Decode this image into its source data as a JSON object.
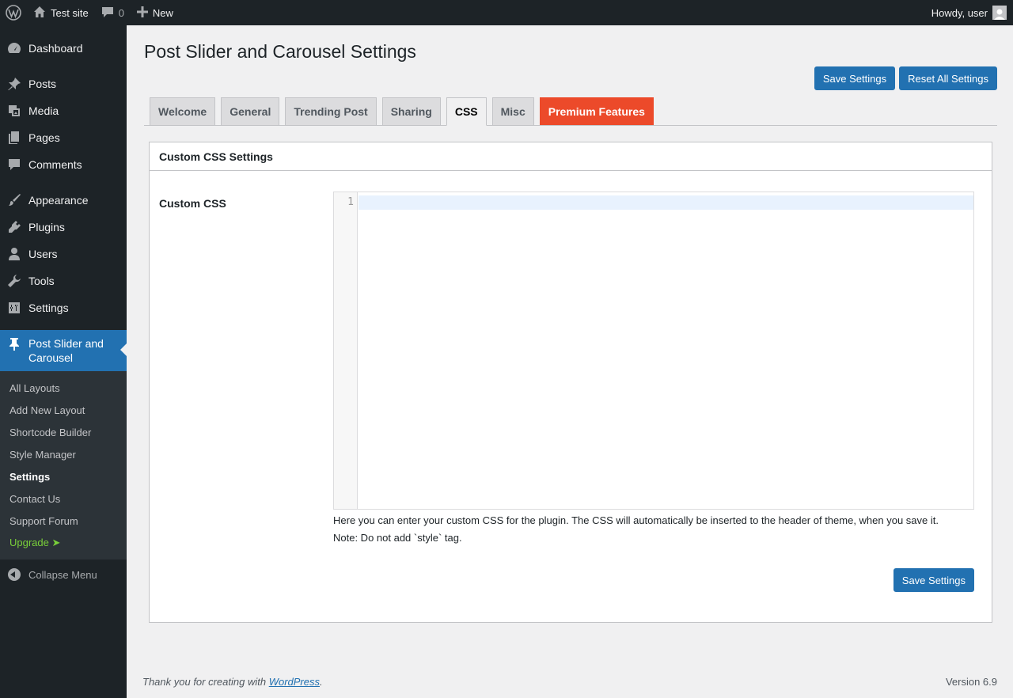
{
  "adminbar": {
    "site_name": "Test site",
    "comments_count": "0",
    "new_label": "New",
    "howdy": "Howdy, user"
  },
  "sidebar": {
    "items": [
      {
        "label": "Dashboard",
        "icon": "dashboard-icon"
      },
      {
        "label": "Posts",
        "icon": "pin-icon"
      },
      {
        "label": "Media",
        "icon": "media-icon"
      },
      {
        "label": "Pages",
        "icon": "pages-icon"
      },
      {
        "label": "Comments",
        "icon": "comment-icon"
      },
      {
        "label": "Appearance",
        "icon": "brush-icon"
      },
      {
        "label": "Plugins",
        "icon": "plug-icon"
      },
      {
        "label": "Users",
        "icon": "user-icon"
      },
      {
        "label": "Tools",
        "icon": "wrench-icon"
      },
      {
        "label": "Settings",
        "icon": "sliders-icon"
      }
    ],
    "current": {
      "label_line1": "Post Slider and",
      "label_line2": "Carousel",
      "icon": "pin-icon"
    },
    "submenu": [
      "All Layouts",
      "Add New Layout",
      "Shortcode Builder",
      "Style Manager",
      "Settings",
      "Contact Us",
      "Support Forum",
      "Upgrade ➤"
    ],
    "collapse_label": "Collapse Menu"
  },
  "page": {
    "title": "Post Slider and Carousel Settings",
    "save_label": "Save Settings",
    "reset_label": "Reset All Settings"
  },
  "tabs": [
    "Welcome",
    "General",
    "Trending Post",
    "Sharing",
    "CSS",
    "Misc",
    "Premium Features"
  ],
  "panel": {
    "header": "Custom CSS Settings",
    "field_label": "Custom CSS",
    "line_number": "1",
    "help_line1": "Here you can enter your custom CSS for the plugin. The CSS will automatically be inserted to the header of theme, when you save it.",
    "help_line2": "Note: Do not add `style` tag.",
    "save_label": "Save Settings"
  },
  "footer": {
    "thanks_prefix": "Thank you for creating with ",
    "link_text": "WordPress",
    "thanks_suffix": ".",
    "version": "Version 6.9"
  },
  "colors": {
    "accent": "#2271b1",
    "premium": "#ec4a2a",
    "sidebar_bg": "#1d2327",
    "upgrade": "#7ad03a"
  }
}
